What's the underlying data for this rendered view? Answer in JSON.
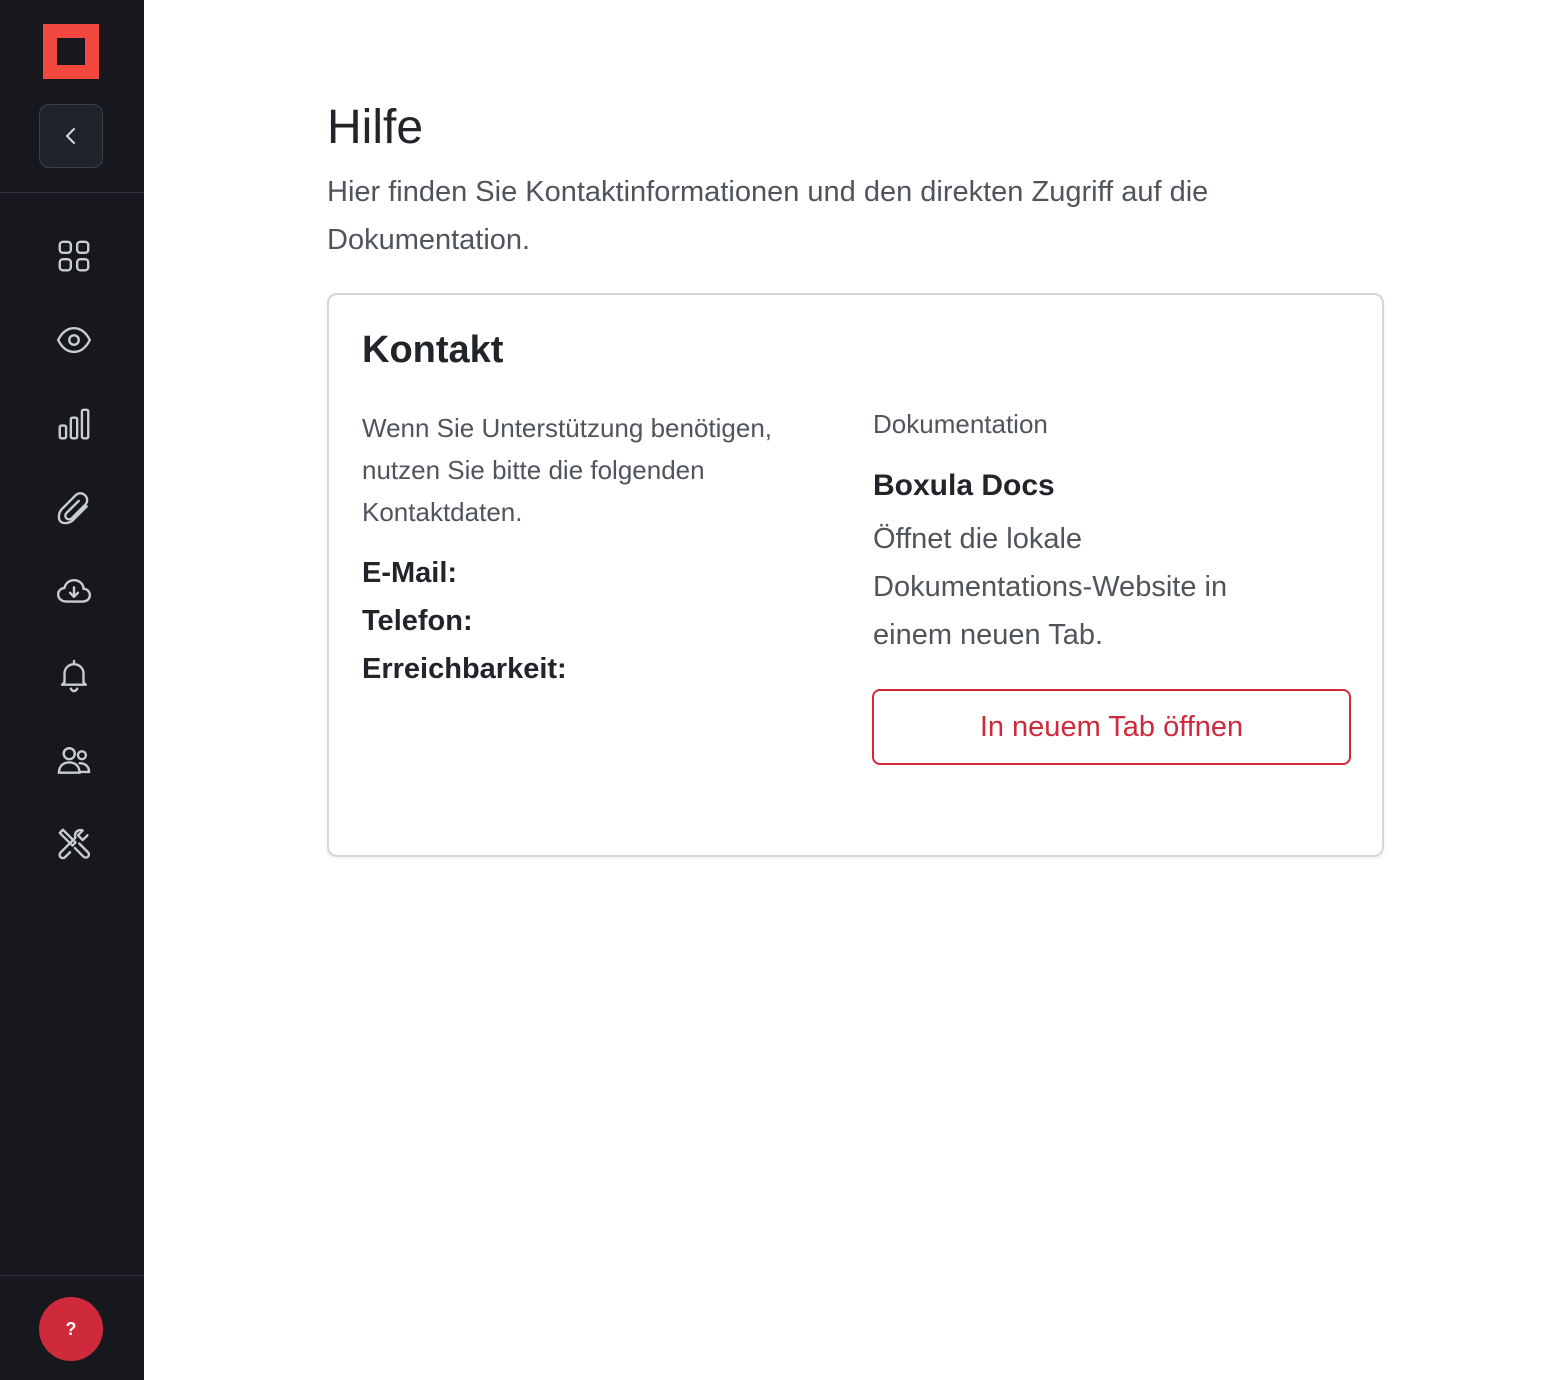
{
  "sidebar": {
    "logo_name": "app-logo",
    "collapse_icon": "chevron-left-icon",
    "nav_items": [
      {
        "icon": "grid-icon"
      },
      {
        "icon": "eye-icon"
      },
      {
        "icon": "bar-chart-icon"
      },
      {
        "icon": "paperclip-icon"
      },
      {
        "icon": "cloud-download-icon"
      },
      {
        "icon": "bell-icon"
      },
      {
        "icon": "users-icon"
      },
      {
        "icon": "tools-icon"
      }
    ],
    "help_label": "?"
  },
  "page": {
    "title": "Hilfe",
    "subtitle": "Hier finden Sie Kontaktinformationen und den direkten Zugriff auf die Dokumentation."
  },
  "contact_card": {
    "title": "Kontakt",
    "intro": "Wenn Sie Unterstützung benötigen, nutzen Sie bitte die folgenden Kontaktdaten.",
    "email_label": "E-Mail:",
    "phone_label": "Telefon:",
    "availability_label": "Erreichbarkeit:"
  },
  "documentation": {
    "section_label": "Dokumentation",
    "title": "Boxula Docs",
    "description": "Öffnet die lokale Dokumentations-Website in einem neuen Tab.",
    "button_label": "In neuem Tab öffnen"
  },
  "colors": {
    "sidebar_bg": "#16181d",
    "accent": "#cf2a3b",
    "logo": "#f2473f"
  }
}
